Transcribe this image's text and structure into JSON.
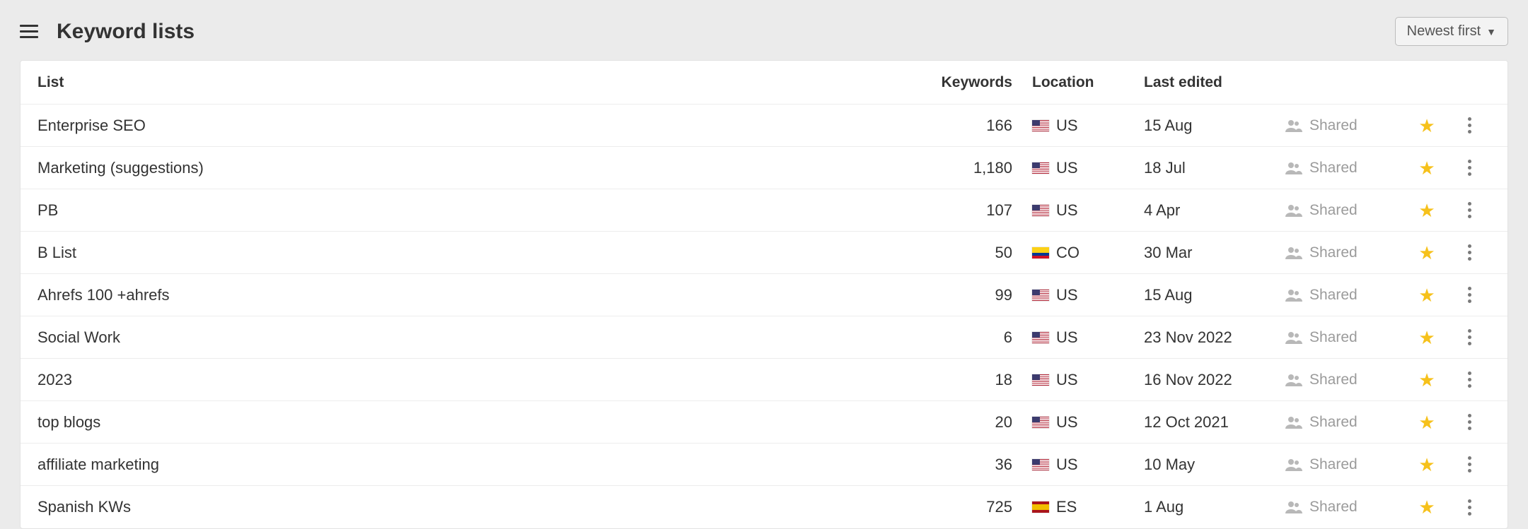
{
  "header": {
    "title": "Keyword lists",
    "sort_label": "Newest first"
  },
  "columns": {
    "list": "List",
    "keywords": "Keywords",
    "location": "Location",
    "last_edited": "Last edited"
  },
  "shared_label": "Shared",
  "rows": [
    {
      "name": "Enterprise SEO",
      "keywords": "166",
      "country_code": "US",
      "flag": "us",
      "last_edited": "15 Aug"
    },
    {
      "name": "Marketing (suggestions)",
      "keywords": "1,180",
      "country_code": "US",
      "flag": "us",
      "last_edited": "18 Jul"
    },
    {
      "name": "PB",
      "keywords": "107",
      "country_code": "US",
      "flag": "us",
      "last_edited": "4 Apr"
    },
    {
      "name": "B List",
      "keywords": "50",
      "country_code": "CO",
      "flag": "co",
      "last_edited": "30 Mar"
    },
    {
      "name": "Ahrefs 100 +ahrefs",
      "keywords": "99",
      "country_code": "US",
      "flag": "us",
      "last_edited": "15 Aug"
    },
    {
      "name": "Social Work",
      "keywords": "6",
      "country_code": "US",
      "flag": "us",
      "last_edited": "23 Nov 2022"
    },
    {
      "name": "2023",
      "keywords": "18",
      "country_code": "US",
      "flag": "us",
      "last_edited": "16 Nov 2022"
    },
    {
      "name": "top blogs",
      "keywords": "20",
      "country_code": "US",
      "flag": "us",
      "last_edited": "12 Oct 2021"
    },
    {
      "name": "affiliate marketing",
      "keywords": "36",
      "country_code": "US",
      "flag": "us",
      "last_edited": "10 May"
    },
    {
      "name": "Spanish KWs",
      "keywords": "725",
      "country_code": "ES",
      "flag": "es",
      "last_edited": "1 Aug"
    }
  ]
}
